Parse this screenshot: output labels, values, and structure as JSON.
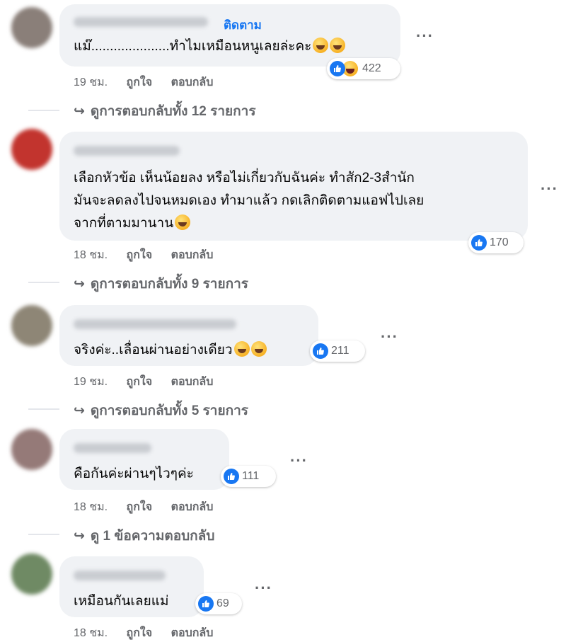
{
  "comments": [
    {
      "follow_label": "ติดตาม",
      "text_lines": [
        "แม๊.....................ทำไมเหมือนหนูเลยล่ะคะ"
      ],
      "reaction_count": "422",
      "time": "19 ชม.",
      "like_label": "ถูกใจ",
      "reply_label": "ตอบกลับ",
      "view_replies": "ดูการตอบกลับทั้ง 12 รายการ"
    },
    {
      "text_lines": [
        "เลือกหัวข้อ เห็นน้อยลง หรือไม่เกี่ยวกับฉันค่ะ ทำสัก2-3สำนัก",
        "มันจะลดลงไปจนหมดเอง ทำมาแล้ว กดเลิกติดตามแอฟไปเลย",
        "จากที่ตามมานาน"
      ],
      "reaction_count": "170",
      "time": "18 ชม.",
      "like_label": "ถูกใจ",
      "reply_label": "ตอบกลับ",
      "view_replies": "ดูการตอบกลับทั้ง 9 รายการ"
    },
    {
      "text_lines": [
        "จริงค่ะ..เลื่อนผ่านอย่างเดียว"
      ],
      "reaction_count": "211",
      "time": "19 ชม.",
      "like_label": "ถูกใจ",
      "reply_label": "ตอบกลับ",
      "view_replies": "ดูการตอบกลับทั้ง 5 รายการ"
    },
    {
      "text_lines": [
        "คือกันค่ะผ่านๆไวๆค่ะ"
      ],
      "reaction_count": "111",
      "time": "18 ชม.",
      "like_label": "ถูกใจ",
      "reply_label": "ตอบกลับ",
      "view_replies": "ดู 1 ข้อความตอบกลับ"
    },
    {
      "text_lines": [
        "เหมือนกันเลยแม่"
      ],
      "reaction_count": "69",
      "time": "18 ชม.",
      "like_label": "ถูกใจ",
      "reply_label": "ตอบกลับ"
    }
  ],
  "more_glyph": "···",
  "reply_arrow": "↪",
  "colors": {
    "accent": "#1877f2",
    "bubble": "#f0f2f5",
    "secondary_text": "#65676b"
  },
  "icons": [
    "like-icon",
    "haha-icon",
    "grin-emoji",
    "more-options-icon",
    "reply-arrow-icon"
  ]
}
